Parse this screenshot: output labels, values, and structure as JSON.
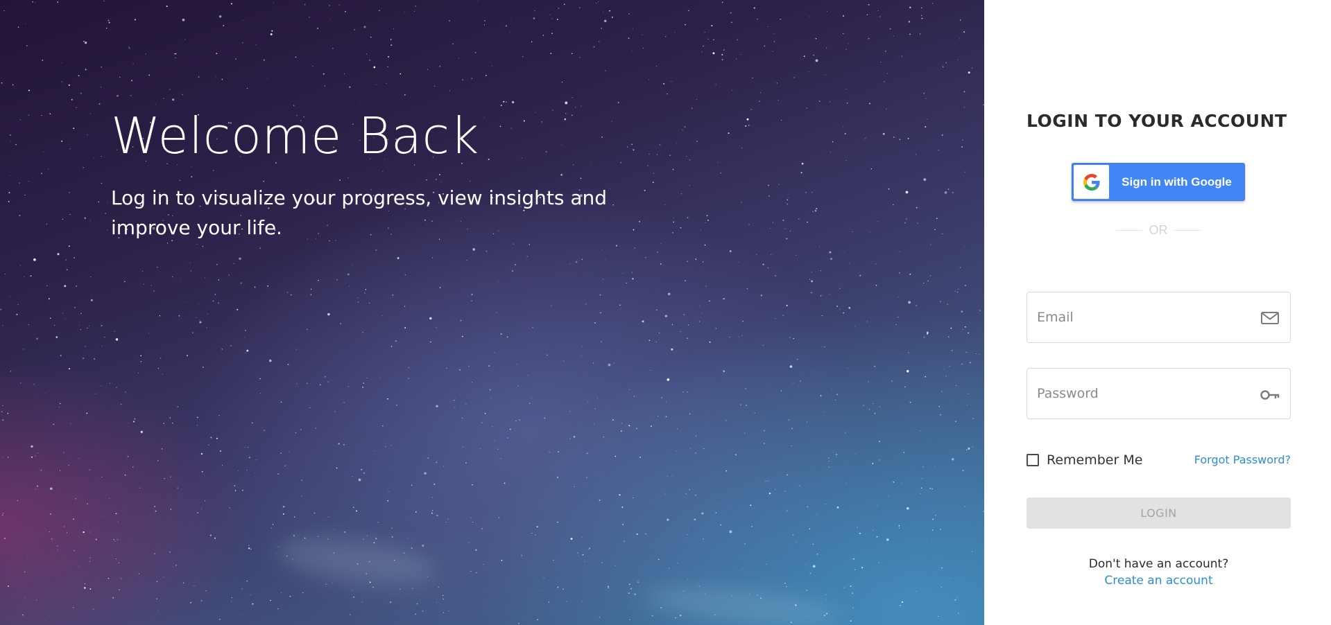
{
  "hero": {
    "title": "Welcome Back",
    "subtitle": "Log in to visualize your progress, view insights and improve your life."
  },
  "login": {
    "title": "LOGIN TO YOUR ACCOUNT",
    "google_button": {
      "label": "Sign in with Google",
      "icon": "google-g-icon"
    },
    "divider_text": "OR",
    "email": {
      "placeholder": "Email",
      "value": "",
      "icon": "envelope-icon"
    },
    "password": {
      "placeholder": "Password",
      "value": "",
      "icon": "key-icon"
    },
    "remember_me": {
      "label": "Remember Me",
      "checked": false
    },
    "forgot_password": "Forgot Password?",
    "login_button": "LOGIN",
    "no_account_text": "Don't have an account?",
    "create_account": "Create an account"
  },
  "colors": {
    "google_blue": "#4285f4",
    "link_blue": "#2a8fd0",
    "disabled_button": "#e2e2e2"
  }
}
